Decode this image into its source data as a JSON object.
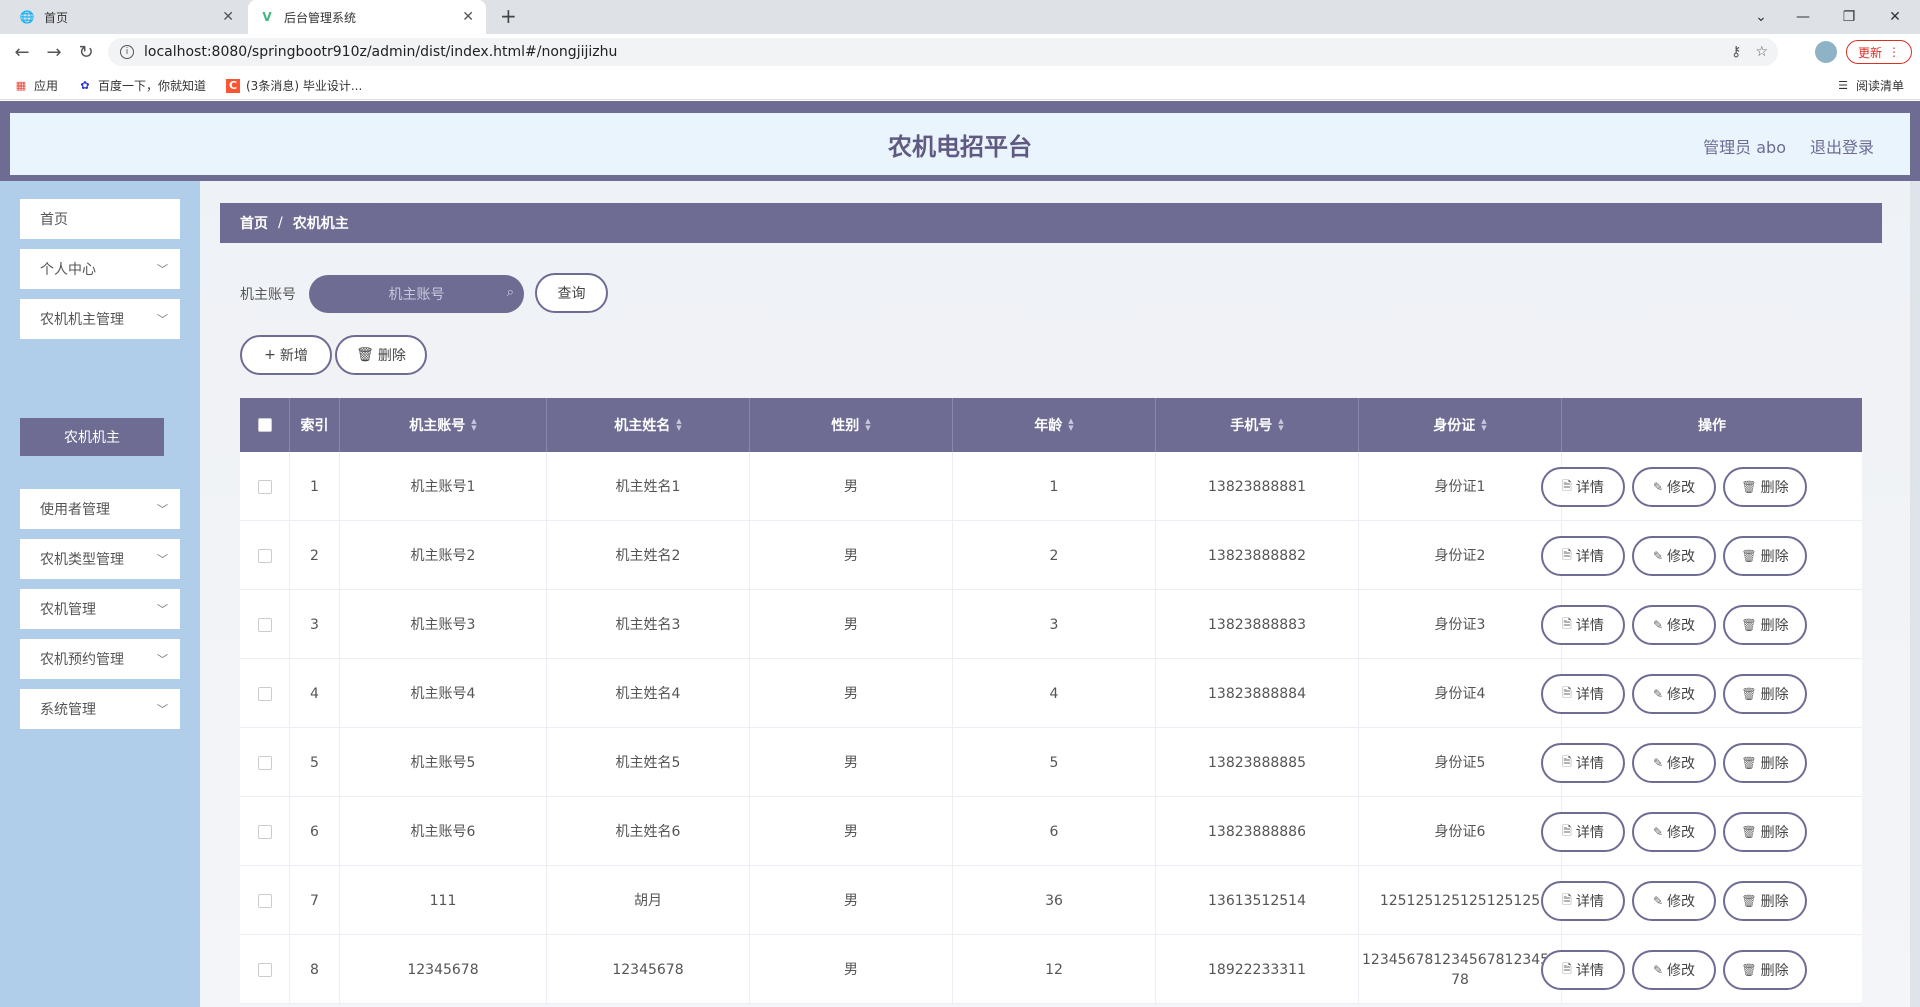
{
  "browser": {
    "tabs": [
      {
        "title": "首页",
        "icon": "globe-icon"
      },
      {
        "title": "后台管理系统",
        "icon": "vue-logo-icon"
      }
    ],
    "url": "localhost:8080/springbootr910z/admin/dist/index.html#/nongjijizhu",
    "update_label": "更新",
    "bookmarks": [
      {
        "label": "应用",
        "icon": "apps-grid-icon"
      },
      {
        "label": "百度一下，你就知道",
        "icon": "baidu-paw-icon"
      },
      {
        "label": "(3条消息) 毕业设计...",
        "icon": "csdn-c-icon"
      }
    ],
    "reading_list": "阅读清单"
  },
  "header": {
    "title": "农机电招平台",
    "user": "管理员 abo",
    "logout": "退出登录"
  },
  "sidebar": {
    "items": [
      {
        "label": "首页",
        "has_children": false
      },
      {
        "label": "个人中心",
        "has_children": true
      },
      {
        "label": "农机机主管理",
        "has_children": true
      },
      {
        "label": "使用者管理",
        "has_children": true
      },
      {
        "label": "农机类型管理",
        "has_children": true
      },
      {
        "label": "农机管理",
        "has_children": true
      },
      {
        "label": "农机预约管理",
        "has_children": true
      },
      {
        "label": "系统管理",
        "has_children": true
      }
    ],
    "active_sub": "农机机主"
  },
  "breadcrumb": {
    "home": "首页",
    "separator": "/",
    "current": "农机机主"
  },
  "search": {
    "label": "机主账号",
    "placeholder": "机主账号",
    "button": "查询"
  },
  "toolbar": {
    "add": "新增",
    "delete": "删除"
  },
  "table": {
    "columns": [
      "索引",
      "机主账号",
      "机主姓名",
      "性别",
      "年龄",
      "手机号",
      "身份证",
      "操作"
    ],
    "rows": [
      [
        "1",
        "机主账号1",
        "机主姓名1",
        "男",
        "1",
        "13823888881",
        "身份证1"
      ],
      [
        "2",
        "机主账号2",
        "机主姓名2",
        "男",
        "2",
        "13823888882",
        "身份证2"
      ],
      [
        "3",
        "机主账号3",
        "机主姓名3",
        "男",
        "3",
        "13823888883",
        "身份证3"
      ],
      [
        "4",
        "机主账号4",
        "机主姓名4",
        "男",
        "4",
        "13823888884",
        "身份证4"
      ],
      [
        "5",
        "机主账号5",
        "机主姓名5",
        "男",
        "5",
        "13823888885",
        "身份证5"
      ],
      [
        "6",
        "机主账号6",
        "机主姓名6",
        "男",
        "6",
        "13823888886",
        "身份证6"
      ],
      [
        "7",
        "111",
        "胡月",
        "男",
        "36",
        "13613512514",
        "125125125125125125"
      ],
      [
        "8",
        "12345678",
        "12345678",
        "男",
        "12",
        "18922233311",
        "1234567812345678123456\n78"
      ]
    ],
    "actions": [
      "详情",
      "修改",
      "删除"
    ]
  },
  "colors": {
    "accent": "#6e6c93",
    "sidebar": "#b0cdea",
    "header_inner": "#eaf4fd"
  }
}
